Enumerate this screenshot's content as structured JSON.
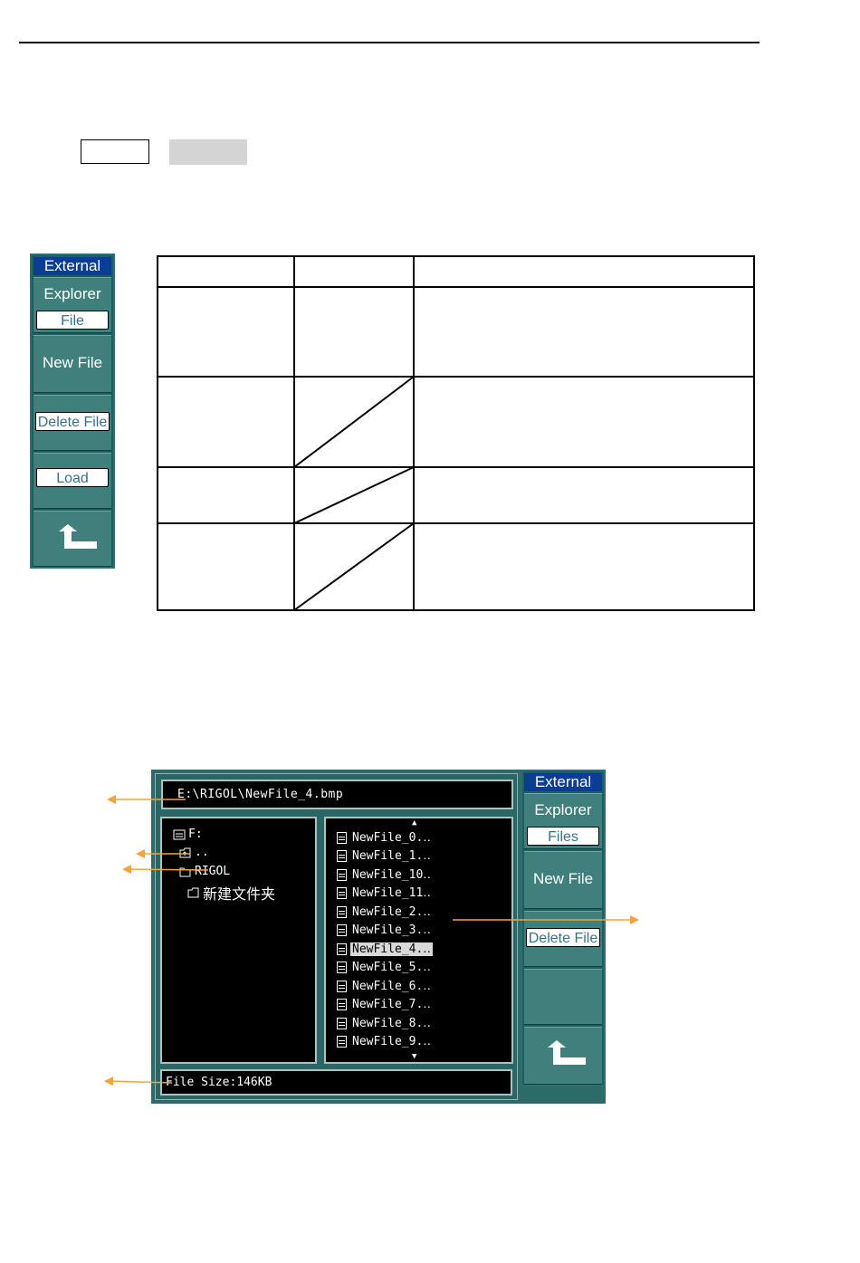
{
  "menu_top": {
    "title": "External",
    "items": [
      {
        "label": "Explorer",
        "chip": "File"
      },
      {
        "label": "New File"
      },
      {
        "label": "",
        "chip": "Delete File"
      },
      {
        "label": "",
        "chip": "Load"
      },
      {
        "label": "",
        "icon": "return-arrow-icon"
      }
    ]
  },
  "screen": {
    "path": "E:\\RIGOL\\NewFile_4.bmp",
    "tree": [
      {
        "icon": "drive-icon",
        "label": "F:"
      },
      {
        "icon": "folder-up-icon",
        "label": ".."
      },
      {
        "icon": "folder-open-icon",
        "label": "RIGOL"
      },
      {
        "icon": "folder-icon",
        "label": "新建文件夹"
      }
    ],
    "files": [
      "NewFile_0.‥",
      "NewFile_1.‥",
      "NewFile_10‥",
      "NewFile_11‥",
      "NewFile_2.‥",
      "NewFile_3.‥",
      "NewFile_4.‥",
      "NewFile_5.‥",
      "NewFile_6.‥",
      "NewFile_7.‥",
      "NewFile_8.‥",
      "NewFile_9.‥"
    ],
    "selected_file_index": 6,
    "file_size": "File Size:146KB"
  },
  "menu_screen": {
    "title": "External",
    "items": [
      {
        "label": "Explorer",
        "chip": "Files"
      },
      {
        "label": "New File"
      },
      {
        "label": "",
        "chip": "Delete File"
      },
      {
        "label": ""
      },
      {
        "label": "",
        "icon": "return-arrow-icon"
      }
    ]
  },
  "colors": {
    "menu_bg": "#1f5e5c",
    "menu_button": "#3f7f7c",
    "title_bar": "#0a3d94",
    "annotation_arrow": "#f5a23a"
  }
}
